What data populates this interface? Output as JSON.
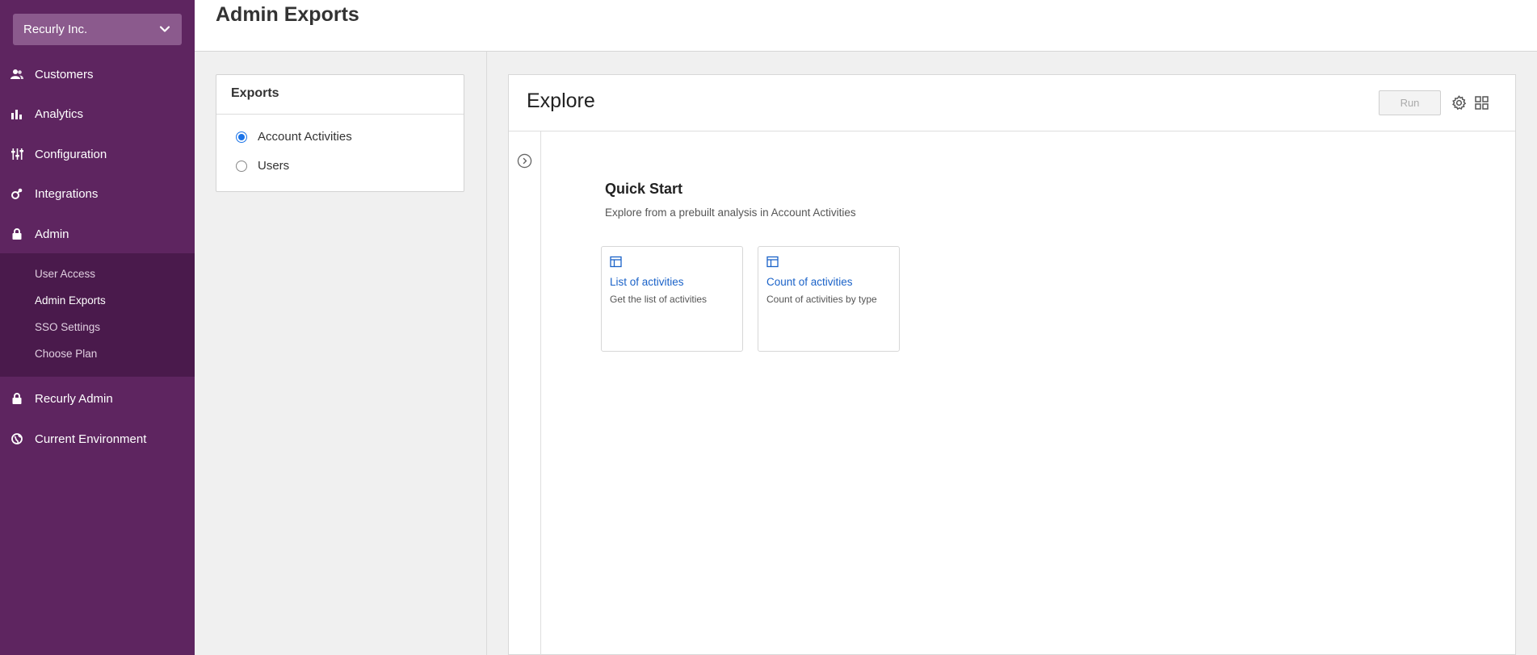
{
  "sidebar": {
    "org_name": "Recurly Inc.",
    "items": [
      {
        "label": "Customers"
      },
      {
        "label": "Analytics"
      },
      {
        "label": "Configuration"
      },
      {
        "label": "Integrations"
      },
      {
        "label": "Admin"
      }
    ],
    "admin_sub": [
      {
        "label": "User Access"
      },
      {
        "label": "Admin Exports"
      },
      {
        "label": "SSO Settings"
      },
      {
        "label": "Choose Plan"
      }
    ],
    "bottom_items": [
      {
        "label": "Recurly Admin"
      },
      {
        "label": "Current Environment"
      }
    ]
  },
  "header": {
    "title": "Admin Exports"
  },
  "exports": {
    "title": "Exports",
    "options": [
      {
        "label": "Account Activities",
        "selected": true
      },
      {
        "label": "Users",
        "selected": false
      }
    ]
  },
  "explore": {
    "title": "Explore",
    "run_label": "Run",
    "quick_start": {
      "title": "Quick Start",
      "subtitle": "Explore from a prebuilt analysis in Account Activities",
      "cards": [
        {
          "title": "List of activities",
          "desc": "Get the list of activities"
        },
        {
          "title": "Count of activities",
          "desc": "Count of activities by type"
        }
      ]
    }
  },
  "colors": {
    "sidebar_bg": "#5e2560",
    "sidebar_sub_bg": "#4a1a4c",
    "link_blue": "#1a62c8",
    "radio_blue": "#1a73e8"
  }
}
